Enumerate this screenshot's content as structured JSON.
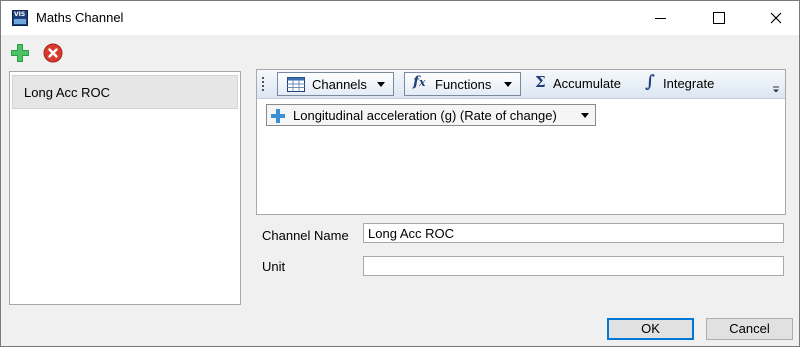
{
  "window": {
    "title": "Maths Channel",
    "app_icon_text": "VIS",
    "controls": [
      "minimize",
      "maximize",
      "close"
    ]
  },
  "toolbar": {
    "add_icon": "plus-icon",
    "delete_icon": "remove-circle-icon",
    "add_color": "#2e9e46",
    "delete_color": "#d93a2f"
  },
  "channel_list": {
    "items": [
      {
        "label": "Long Acc ROC",
        "selected": true
      }
    ]
  },
  "editor": {
    "toolbar": {
      "channels_label": "Channels",
      "functions_label": "Functions",
      "functions_icon": "fx",
      "accumulate_label": "Accumulate",
      "accumulate_icon": "Σ",
      "integrate_label": "Integrate",
      "integrate_icon": "∫"
    },
    "expression_token": "Longitudinal acceleration (g) (Rate of change)"
  },
  "form": {
    "channel_name_label": "Channel Name",
    "channel_name_value": "Long Acc ROC",
    "unit_label": "Unit",
    "unit_value": ""
  },
  "buttons": {
    "ok": "OK",
    "cancel": "Cancel"
  },
  "colors": {
    "accent": "#0078d7",
    "icon_blue": "#1f3f7a",
    "token_plus": "#3a8fd6"
  }
}
